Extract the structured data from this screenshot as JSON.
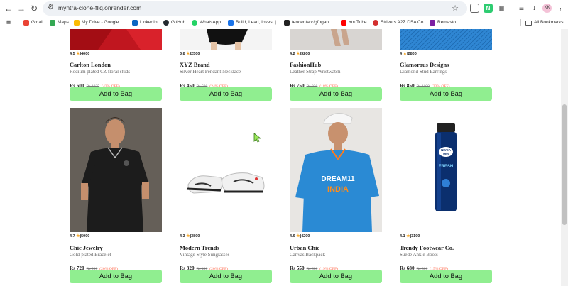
{
  "browser": {
    "url": "myntra-clone-fllq.onrender.com",
    "profile": "KK",
    "bookmarks": [
      {
        "label": "Gmail",
        "color": "#ea4335"
      },
      {
        "label": "Maps",
        "color": "#34a853"
      },
      {
        "label": "My Drive - Google...",
        "color": "#fbbc04"
      },
      {
        "label": "LinkedIn",
        "color": "#0a66c2"
      },
      {
        "label": "GitHub",
        "color": "#24292f"
      },
      {
        "label": "WhatsApp",
        "color": "#25d366"
      },
      {
        "label": "Build, Lead, Invest |...",
        "color": "#1a73e8"
      },
      {
        "label": "tencentarc/gfpgan...",
        "color": "#222222"
      },
      {
        "label": "YouTube",
        "color": "#ff0000"
      },
      {
        "label": "Strivers A2Z DSA Co...",
        "color": "#d32f2f"
      },
      {
        "label": "Remasto",
        "color": "#7b1fa2"
      }
    ],
    "all_bookmarks": "All Bookmarks"
  },
  "products_top": [
    {
      "rating": "4.5",
      "count": "4000",
      "brand": "Carlton London",
      "desc": "Rodium plated CZ floral studs",
      "price": "Rs 600",
      "old": "Rs 1035",
      "off": "(42% OFF)",
      "cta": "Add to Bag"
    },
    {
      "rating": "3.8",
      "count": "2500",
      "brand": "XYZ Brand",
      "desc": "Silver Heart Pendant Necklace",
      "price": "Rs 450",
      "old": "Rs 590",
      "off": "(24% OFF)",
      "cta": "Add to Bag"
    },
    {
      "rating": "4.2",
      "count": "3200",
      "brand": "FashionHub",
      "desc": "Leather Strap Wristwatch",
      "price": "Rs 750",
      "old": "Rs 920",
      "off": "(18% OFF)",
      "cta": "Add to Bag"
    },
    {
      "rating": "4",
      "count": "2800",
      "brand": "Glamorous Designs",
      "desc": "Diamond Stud Earrings",
      "price": "Rs 850",
      "old": "Rs 1100",
      "off": "(23% OFF)",
      "cta": "Add to Bag"
    }
  ],
  "products_bottom": [
    {
      "rating": "4.7",
      "count": "5000",
      "brand": "Chic Jewelry",
      "desc": "Gold-plated Bracelet",
      "price": "Rs 720",
      "old": "Rs 900",
      "off": "(20% OFF)",
      "cta": "Add to Bag"
    },
    {
      "rating": "4.3",
      "count": "3800",
      "brand": "Modern Trends",
      "desc": "Vintage Style Sunglasses",
      "price": "Rs 320",
      "old": "Rs 400",
      "off": "(20% OFF)",
      "cta": "Add to Bag"
    },
    {
      "rating": "4.6",
      "count": "4200",
      "brand": "Urban Chic",
      "desc": "Canvas Backpack",
      "price": "Rs 550",
      "old": "Rs 680",
      "off": "(19% OFF)",
      "cta": "Add to Bag"
    },
    {
      "rating": "4.1",
      "count": "3100",
      "brand": "Trendy Footwear Co.",
      "desc": "Suede Ankle Boots",
      "price": "Rs 680",
      "old": "Rs 800",
      "off": "(15% OFF)",
      "cta": "Add to Bag"
    }
  ],
  "image_text": {
    "jersey": "DREAM11 INDIA",
    "nivea": "NIVEA MEN FRESH"
  }
}
